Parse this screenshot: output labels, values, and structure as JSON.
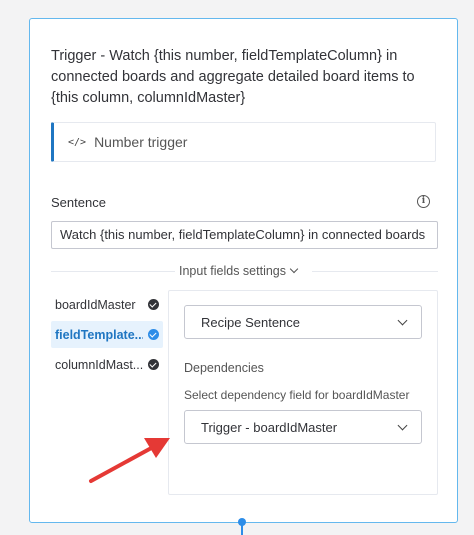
{
  "card": {
    "title": "Trigger - Watch {this number, fieldTemplateColumn} in connected boards and aggregate detailed board items to {this column, columnIdMaster}",
    "trigger_icon": "</>",
    "trigger_label": "Number trigger"
  },
  "sentence": {
    "label": "Sentence",
    "info_icon": "i",
    "value": "Watch {this number, fieldTemplateColumn} in connected boards"
  },
  "input_fields": {
    "toggle_label": "Input fields settings",
    "fields": [
      {
        "label": "boardIdMaster",
        "status": "done",
        "active": false
      },
      {
        "label": "fieldTemplate...",
        "status": "done",
        "active": true
      },
      {
        "label": "columnIdMast...",
        "status": "done",
        "active": false
      }
    ]
  },
  "panel": {
    "source_dropdown": "Recipe Sentence",
    "dependencies_title": "Dependencies",
    "dependency_prompt": "Select dependency field for boardIdMaster",
    "dependency_dropdown": "Trigger - boardIdMaster"
  },
  "colors": {
    "accent": "#1f76c2",
    "card_border": "#64b8ee",
    "check_active": "#2d8de8",
    "annotation_arrow": "#e53935"
  }
}
